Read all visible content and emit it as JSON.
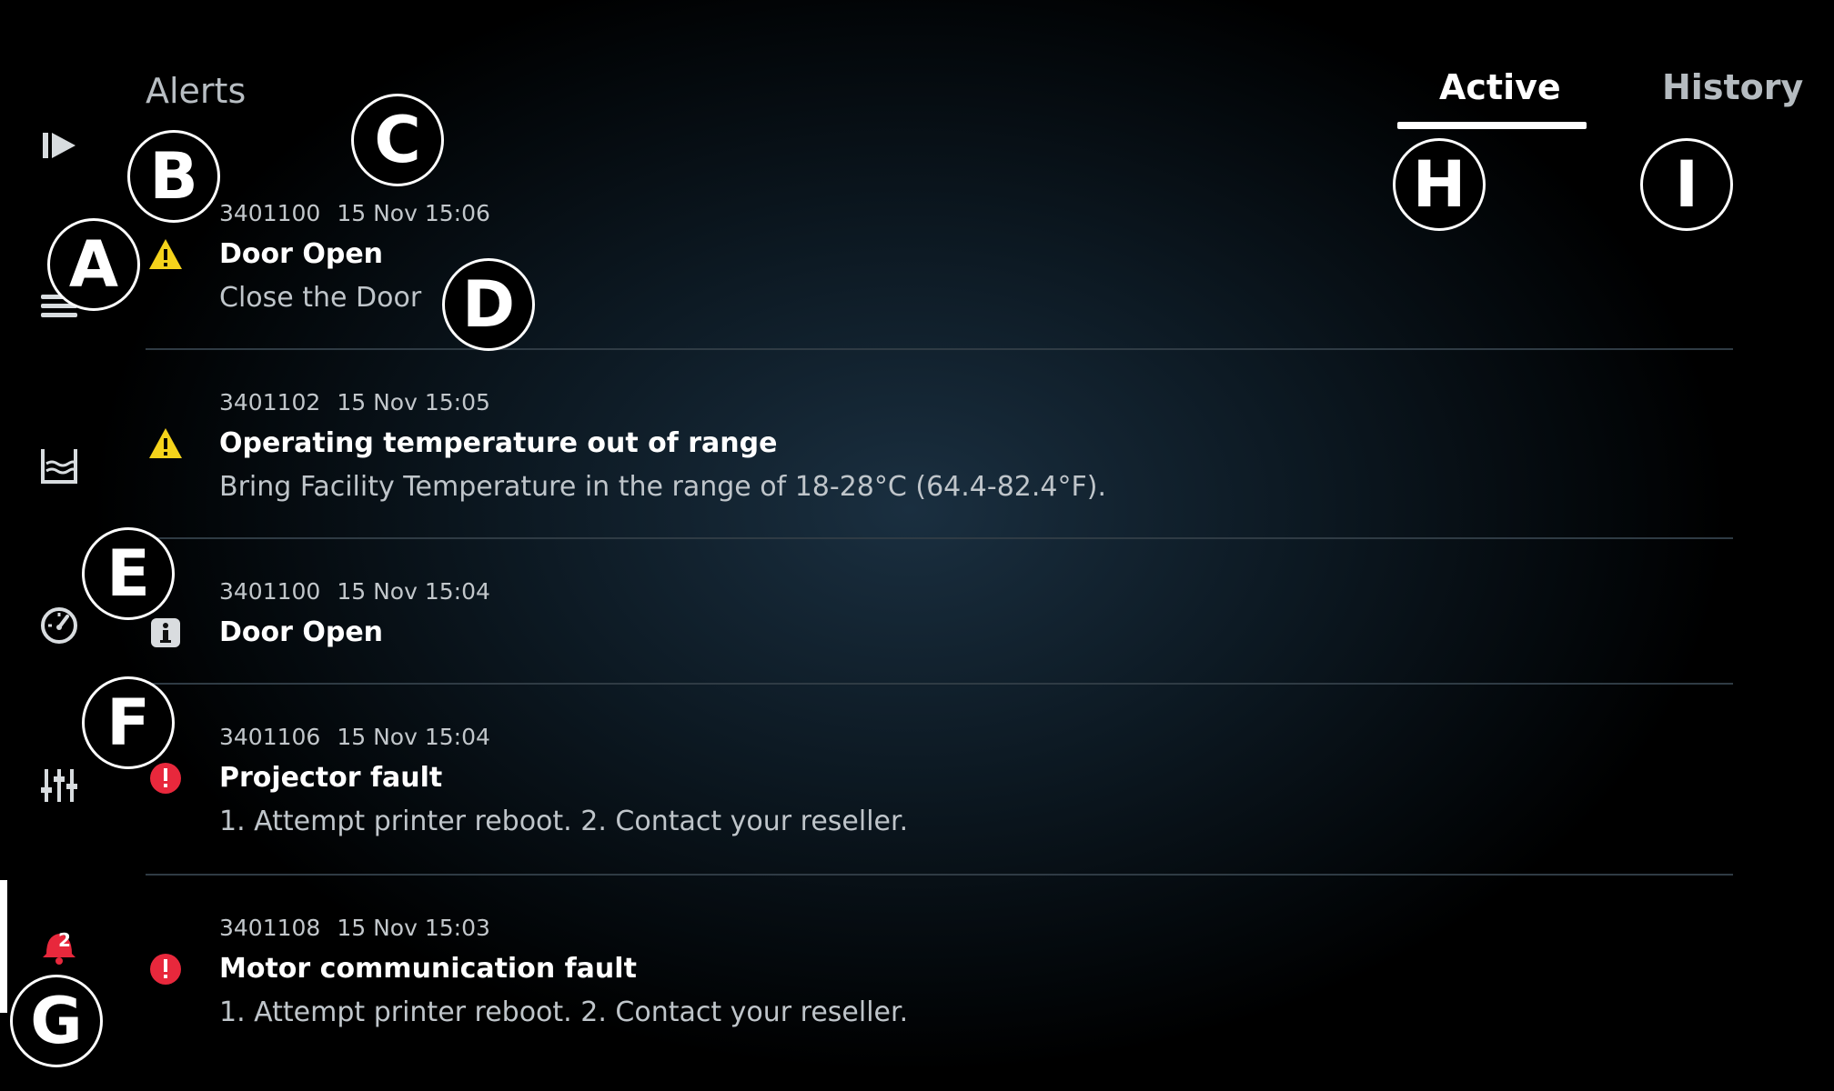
{
  "header": {
    "title": "Alerts",
    "tabs": [
      {
        "label": "Active"
      },
      {
        "label": "History"
      }
    ]
  },
  "sidebar": {
    "items": [
      {
        "icon": "play-icon"
      },
      {
        "icon": "menu-icon"
      },
      {
        "icon": "tank-icon"
      },
      {
        "icon": "gauge-icon"
      },
      {
        "icon": "sliders-icon"
      },
      {
        "icon": "bell-icon",
        "badge": "2"
      }
    ]
  },
  "alerts": [
    {
      "code": "3401100",
      "date": "15 Nov 15:06",
      "title": "Door Open",
      "description": "Close the Door",
      "severity": "warning"
    },
    {
      "code": "3401102",
      "date": "15 Nov 15:05",
      "title": "Operating temperature out of range",
      "description": "Bring Facility Temperature in the range of 18-28°C (64.4-82.4°F).",
      "severity": "warning"
    },
    {
      "code": "3401100",
      "date": "15 Nov 15:04",
      "title": "Door Open",
      "description": "",
      "severity": "info"
    },
    {
      "code": "3401106",
      "date": "15 Nov 15:04",
      "title": "Projector fault",
      "description": "1. Attempt printer reboot. 2. Contact your reseller.",
      "severity": "error"
    },
    {
      "code": "3401108",
      "date": "15 Nov 15:03",
      "title": "Motor communication fault",
      "description": "1. Attempt printer reboot. 2. Contact your reseller.",
      "severity": "error"
    }
  ],
  "annotations": [
    "A",
    "B",
    "C",
    "D",
    "E",
    "F",
    "G",
    "H",
    "I"
  ],
  "colors": {
    "warning": "#f5d31b",
    "error": "#e8283c",
    "info": "#d9dcdf",
    "divider": "#2f3b44"
  }
}
